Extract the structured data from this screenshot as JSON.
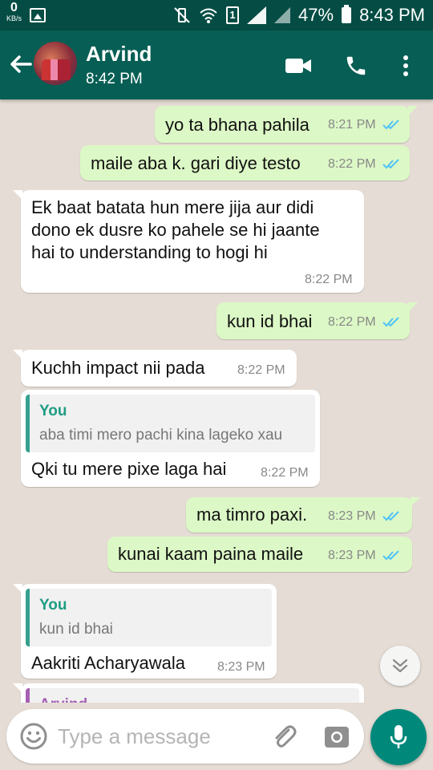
{
  "status_bar": {
    "speed_value": "0",
    "speed_unit": "KB/s",
    "sim_slot": "1",
    "battery": "47%",
    "time": "8:43 PM"
  },
  "header": {
    "contact_name": "Arvind",
    "subtitle": "8:42 PM",
    "icons": [
      "back-arrow-icon",
      "video-call-icon",
      "phone-icon",
      "more-vert-icon"
    ]
  },
  "messages": [
    {
      "dir": "out",
      "text": "yo ta bhana pahila",
      "time": "8:21 PM",
      "status": "read"
    },
    {
      "dir": "out",
      "text": "maile aba k. gari diye testo",
      "time": "8:22 PM",
      "status": "read"
    },
    {
      "dir": "in",
      "lines": [
        "Ek baat batata hun mere jija aur didi",
        "dono ek dusre ko pahele se hi jaante",
        "hai to understanding to hogi hi"
      ],
      "time": "8:22 PM"
    },
    {
      "dir": "out",
      "text": "kun id bhai",
      "time": "8:22 PM",
      "status": "read"
    },
    {
      "dir": "in",
      "text": "Kuchh impact nii pada",
      "time": "8:22 PM"
    },
    {
      "dir": "in",
      "quote": {
        "author": "You",
        "text": "aba timi mero pachi kina lageko xau"
      },
      "text": "Qki tu mere pixe laga hai",
      "time": "8:22 PM"
    },
    {
      "dir": "out",
      "text": "ma timro paxi.",
      "time": "8:23 PM",
      "status": "read"
    },
    {
      "dir": "out",
      "text": "kunai kaam paina maile",
      "time": "8:23 PM",
      "status": "read"
    },
    {
      "dir": "in",
      "quote": {
        "author": "You",
        "text": "kun id bhai"
      },
      "text": "Aakriti Acharyawala",
      "time": "8:23 PM"
    },
    {
      "dir": "in",
      "quote": {
        "author": "Arvind",
        "text": ""
      },
      "partial": true
    }
  ],
  "composer": {
    "placeholder": "Type a message"
  },
  "colors": {
    "header": "#075e54",
    "status_bar": "#054d44",
    "outgoing_bubble": "#dcf8c6",
    "incoming_bubble": "#ffffff",
    "chat_background": "#e5ddd5",
    "read_ticks": "#4fc3f7",
    "mic_button": "#00897b"
  }
}
